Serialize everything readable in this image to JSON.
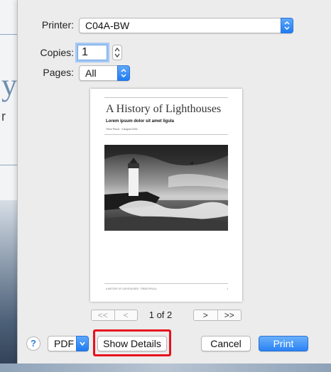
{
  "printer": {
    "label": "Printer:",
    "value": "C04A-BW"
  },
  "copies": {
    "label": "Copies:",
    "value": "1"
  },
  "pages": {
    "label": "Pages:",
    "value": "All"
  },
  "preview": {
    "title": "A History of Lighthouses",
    "subtitle": "Lorem ipsum dolor sit amet ligula",
    "byline": "Trenz Pruca · 4 August 2016",
    "footer_left": "A HISTORY OF LIGHTHOUSES · TRENZ PRUCA",
    "footer_right": "1"
  },
  "navigation": {
    "first": "<<",
    "prev": "<",
    "page_indicator": "1 of 2",
    "next": ">",
    "last": ">>"
  },
  "buttons": {
    "help": "?",
    "pdf": "PDF",
    "show_details": "Show Details",
    "cancel": "Cancel",
    "print": "Print"
  },
  "colors": {
    "accent": "#2a82f3",
    "highlight": "#e8101d",
    "sheet_bg": "#ececec"
  }
}
